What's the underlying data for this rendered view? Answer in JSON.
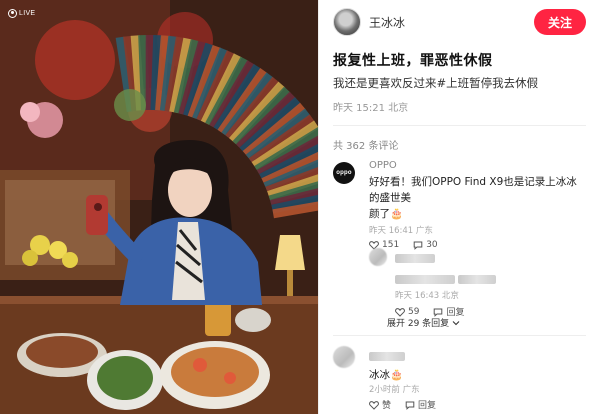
{
  "photo": {
    "live_label": "LIVE",
    "colors": {
      "book_spines": [
        "#2e5e6e",
        "#8a3a2a",
        "#c9a24a",
        "#3c6b4a",
        "#6a2a3a",
        "#1f4a63",
        "#b3532e"
      ],
      "jacket": "#3a62a8",
      "table": "#6b3a1f"
    }
  },
  "post": {
    "author_name": "王冰冰",
    "follow_label": "关注",
    "title": "报复性上班，罪恶性休假",
    "body": "我还是更喜欢反过来#上班暂停我去休假",
    "time": "昨天 15:21",
    "location": "北京",
    "comment_count_text": "共 362 条评论"
  },
  "comments": [
    {
      "name": "OPPO",
      "avatar_text": "oppo",
      "text_line1": "好好看！我们OPPO Find X9也是记录上冰冰的盛世美",
      "text_line2": "颜了🎂",
      "time": "昨天 16:41",
      "location": "广东",
      "likes": "151",
      "replies": "30"
    },
    {
      "name": "",
      "time": "昨天 16:43",
      "location": "北京",
      "likes": "59",
      "reply_label": "回复",
      "expand_label": "展开 29 条回复"
    },
    {
      "name": "",
      "text": "冰冰🎂",
      "time": "2小时前",
      "location": "广东",
      "like_label": "赞",
      "reply_label": "回复"
    }
  ],
  "colors": {
    "accent": "#ff2442",
    "muted": "#999999"
  }
}
